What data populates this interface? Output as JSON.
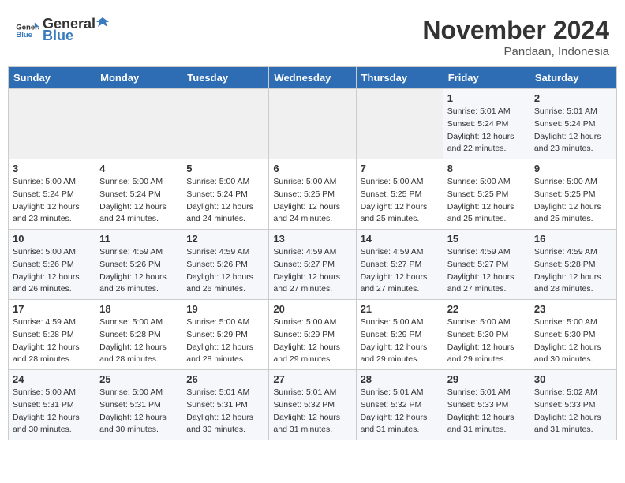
{
  "header": {
    "logo_general": "General",
    "logo_blue": "Blue",
    "month_title": "November 2024",
    "subtitle": "Pandaan, Indonesia"
  },
  "columns": [
    "Sunday",
    "Monday",
    "Tuesday",
    "Wednesday",
    "Thursday",
    "Friday",
    "Saturday"
  ],
  "weeks": [
    [
      {
        "day": "",
        "info": ""
      },
      {
        "day": "",
        "info": ""
      },
      {
        "day": "",
        "info": ""
      },
      {
        "day": "",
        "info": ""
      },
      {
        "day": "",
        "info": ""
      },
      {
        "day": "1",
        "info": "Sunrise: 5:01 AM\nSunset: 5:24 PM\nDaylight: 12 hours and 22 minutes."
      },
      {
        "day": "2",
        "info": "Sunrise: 5:01 AM\nSunset: 5:24 PM\nDaylight: 12 hours and 23 minutes."
      }
    ],
    [
      {
        "day": "3",
        "info": "Sunrise: 5:00 AM\nSunset: 5:24 PM\nDaylight: 12 hours and 23 minutes."
      },
      {
        "day": "4",
        "info": "Sunrise: 5:00 AM\nSunset: 5:24 PM\nDaylight: 12 hours and 24 minutes."
      },
      {
        "day": "5",
        "info": "Sunrise: 5:00 AM\nSunset: 5:24 PM\nDaylight: 12 hours and 24 minutes."
      },
      {
        "day": "6",
        "info": "Sunrise: 5:00 AM\nSunset: 5:25 PM\nDaylight: 12 hours and 24 minutes."
      },
      {
        "day": "7",
        "info": "Sunrise: 5:00 AM\nSunset: 5:25 PM\nDaylight: 12 hours and 25 minutes."
      },
      {
        "day": "8",
        "info": "Sunrise: 5:00 AM\nSunset: 5:25 PM\nDaylight: 12 hours and 25 minutes."
      },
      {
        "day": "9",
        "info": "Sunrise: 5:00 AM\nSunset: 5:25 PM\nDaylight: 12 hours and 25 minutes."
      }
    ],
    [
      {
        "day": "10",
        "info": "Sunrise: 5:00 AM\nSunset: 5:26 PM\nDaylight: 12 hours and 26 minutes."
      },
      {
        "day": "11",
        "info": "Sunrise: 4:59 AM\nSunset: 5:26 PM\nDaylight: 12 hours and 26 minutes."
      },
      {
        "day": "12",
        "info": "Sunrise: 4:59 AM\nSunset: 5:26 PM\nDaylight: 12 hours and 26 minutes."
      },
      {
        "day": "13",
        "info": "Sunrise: 4:59 AM\nSunset: 5:27 PM\nDaylight: 12 hours and 27 minutes."
      },
      {
        "day": "14",
        "info": "Sunrise: 4:59 AM\nSunset: 5:27 PM\nDaylight: 12 hours and 27 minutes."
      },
      {
        "day": "15",
        "info": "Sunrise: 4:59 AM\nSunset: 5:27 PM\nDaylight: 12 hours and 27 minutes."
      },
      {
        "day": "16",
        "info": "Sunrise: 4:59 AM\nSunset: 5:28 PM\nDaylight: 12 hours and 28 minutes."
      }
    ],
    [
      {
        "day": "17",
        "info": "Sunrise: 4:59 AM\nSunset: 5:28 PM\nDaylight: 12 hours and 28 minutes."
      },
      {
        "day": "18",
        "info": "Sunrise: 5:00 AM\nSunset: 5:28 PM\nDaylight: 12 hours and 28 minutes."
      },
      {
        "day": "19",
        "info": "Sunrise: 5:00 AM\nSunset: 5:29 PM\nDaylight: 12 hours and 28 minutes."
      },
      {
        "day": "20",
        "info": "Sunrise: 5:00 AM\nSunset: 5:29 PM\nDaylight: 12 hours and 29 minutes."
      },
      {
        "day": "21",
        "info": "Sunrise: 5:00 AM\nSunset: 5:29 PM\nDaylight: 12 hours and 29 minutes."
      },
      {
        "day": "22",
        "info": "Sunrise: 5:00 AM\nSunset: 5:30 PM\nDaylight: 12 hours and 29 minutes."
      },
      {
        "day": "23",
        "info": "Sunrise: 5:00 AM\nSunset: 5:30 PM\nDaylight: 12 hours and 30 minutes."
      }
    ],
    [
      {
        "day": "24",
        "info": "Sunrise: 5:00 AM\nSunset: 5:31 PM\nDaylight: 12 hours and 30 minutes."
      },
      {
        "day": "25",
        "info": "Sunrise: 5:00 AM\nSunset: 5:31 PM\nDaylight: 12 hours and 30 minutes."
      },
      {
        "day": "26",
        "info": "Sunrise: 5:01 AM\nSunset: 5:31 PM\nDaylight: 12 hours and 30 minutes."
      },
      {
        "day": "27",
        "info": "Sunrise: 5:01 AM\nSunset: 5:32 PM\nDaylight: 12 hours and 31 minutes."
      },
      {
        "day": "28",
        "info": "Sunrise: 5:01 AM\nSunset: 5:32 PM\nDaylight: 12 hours and 31 minutes."
      },
      {
        "day": "29",
        "info": "Sunrise: 5:01 AM\nSunset: 5:33 PM\nDaylight: 12 hours and 31 minutes."
      },
      {
        "day": "30",
        "info": "Sunrise: 5:02 AM\nSunset: 5:33 PM\nDaylight: 12 hours and 31 minutes."
      }
    ]
  ]
}
